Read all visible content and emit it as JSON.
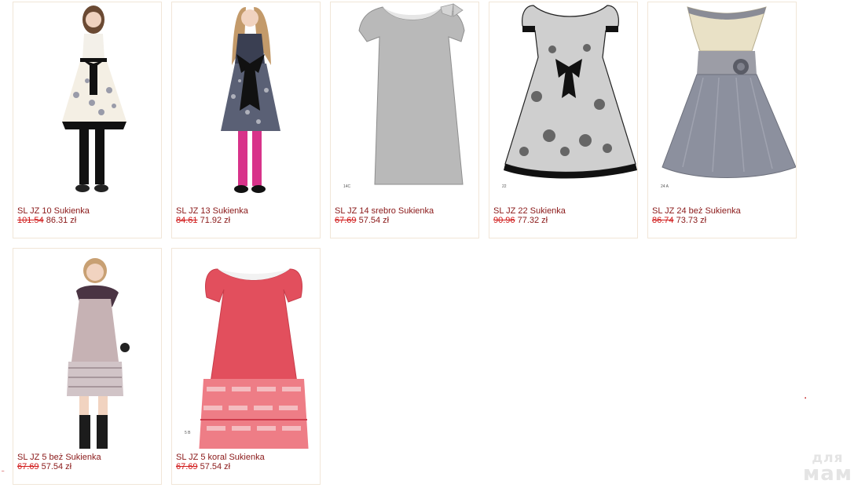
{
  "products": [
    {
      "name": "SL JZ 10 Sukienka",
      "old_price": "101.54",
      "new_price": "86.31 zł",
      "code": ""
    },
    {
      "name": "SL JZ 13 Sukienka",
      "old_price": "84.61",
      "new_price": "71.92 zł",
      "code": ""
    },
    {
      "name": "SL JZ 14 srebro Sukienka",
      "old_price": "67.69",
      "new_price": "57.54 zł",
      "code": "14C"
    },
    {
      "name": "SL JZ 22 Sukienka",
      "old_price": "90.96",
      "new_price": "77.32 zł",
      "code": "22"
    },
    {
      "name": "SL JZ 24 beż Sukienka",
      "old_price": "86.74",
      "new_price": "73.73 zł",
      "code": "24 A"
    },
    {
      "name": "SL JZ 5 beż Sukienka",
      "old_price": "67.69",
      "new_price": "57.54 zł",
      "code": ""
    },
    {
      "name": "SL JZ 5 koral Sukienka",
      "old_price": "67.69",
      "new_price": "57.54 zł",
      "code": "5 B"
    }
  ],
  "watermark": {
    "line1": "для",
    "line2": "мам"
  },
  "colors": {
    "product_link": "#8a1818",
    "old_price": "#d01717",
    "card_border": "#f1e6d8"
  }
}
